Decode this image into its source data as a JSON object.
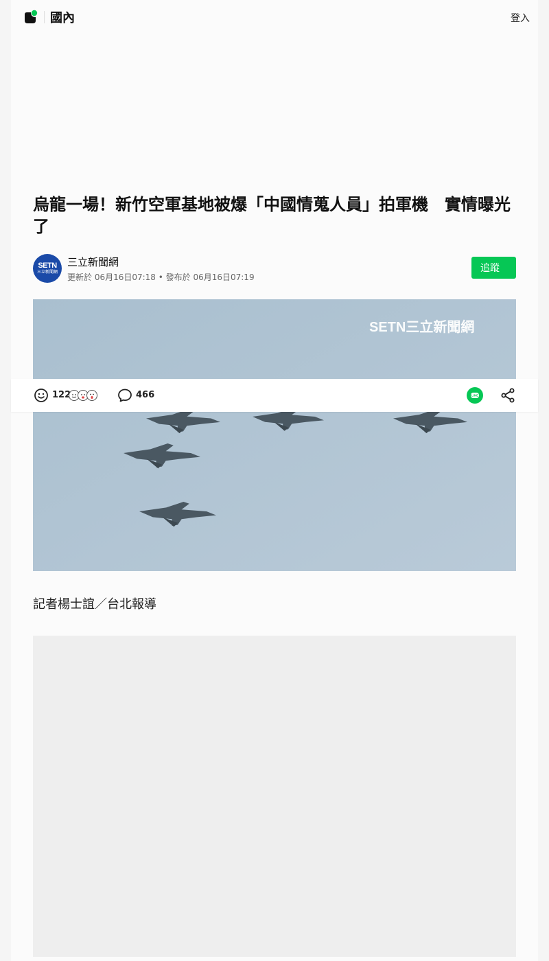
{
  "header": {
    "section_title": "國內",
    "login_label": "登入"
  },
  "article": {
    "headline": "烏龍一場！新竹空軍基地被爆「中國情蒐人員」拍軍機　實情曝光了",
    "author": {
      "name": "三立新聞網",
      "avatar_text": "SETN",
      "avatar_subtext": "三立新聞網",
      "meta": "更新於 06月16日07:18 • 發布於 06月16日07:19"
    },
    "follow_label": "追蹤",
    "image_watermark": "SETN三立新聞網",
    "byline": "記者楊士誼／台北報導"
  },
  "engagement": {
    "reaction_count": "122",
    "comment_count": "466"
  },
  "icons": {
    "logo": "line-today-logo",
    "reaction": "smiley-icon",
    "comment": "speech-bubble-icon",
    "line_share": "line-share-icon",
    "share": "share-icon"
  },
  "colors": {
    "accent_green": "#06c755",
    "avatar_blue": "#1a4aa8",
    "sky": "#b1c5d5"
  }
}
